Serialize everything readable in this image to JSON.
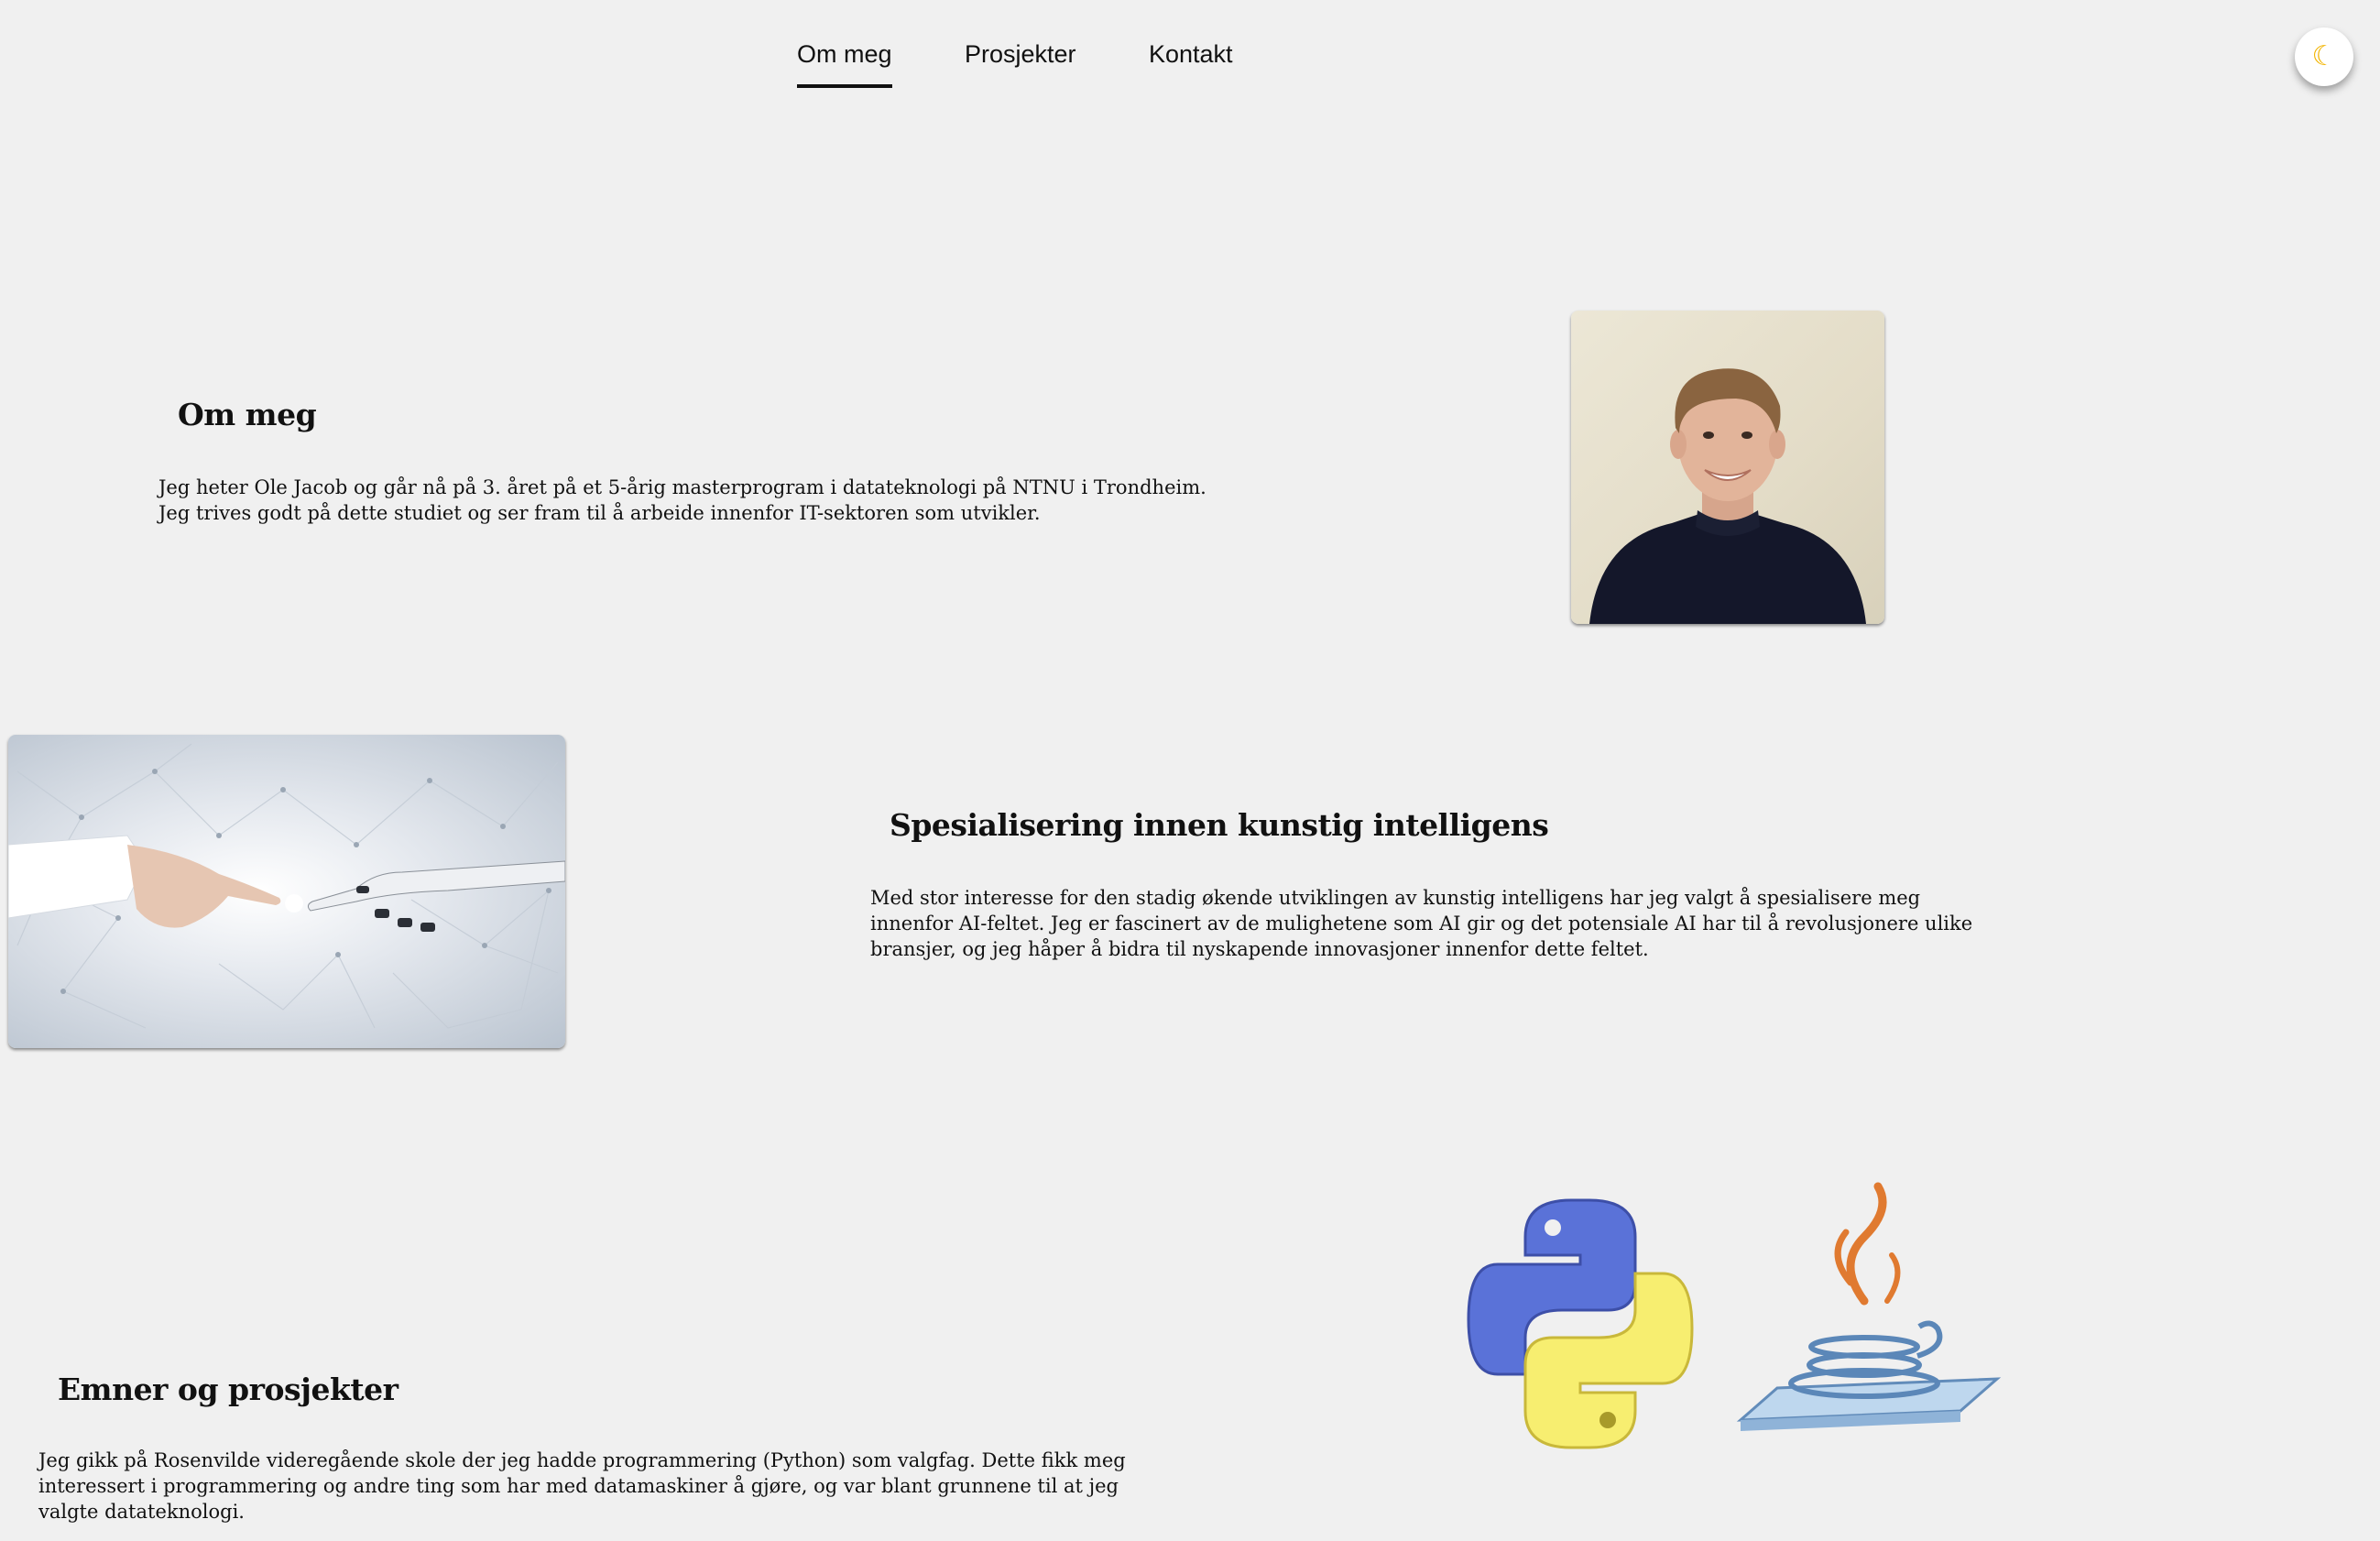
{
  "nav": {
    "items": [
      {
        "label": "Om meg",
        "active": true
      },
      {
        "label": "Prosjekter",
        "active": false
      },
      {
        "label": "Kontakt",
        "active": false
      }
    ],
    "theme_toggle_icon": "moon-icon"
  },
  "about": {
    "heading": "Om meg",
    "text": "Jeg heter Ole Jacob og går nå på 3. året på et 5-årig masterprogram i datateknologi på NTNU i Trondheim. Jeg trives godt på dette studiet og ser fram til å arbeide innenfor IT-sektoren som utvikler."
  },
  "ai": {
    "heading": "Spesialisering innen kunstig intelligens",
    "text": "Med stor interesse for den stadig økende utviklingen av kunstig intelligens har jeg valgt å spesialisere meg innenfor AI-feltet. Jeg er fascinert av de mulighetene som AI gir og det potensiale AI har til å revolusjonere ulike bransjer, og jeg håper å bidra til nyskapende innovasjoner innenfor dette feltet."
  },
  "projects": {
    "heading": "Emner og prosjekter",
    "text": "Jeg gikk på Rosenvilde videregående skole der jeg hadde programmering (Python) som valgfag. Dette fikk meg interessert i programmering og andre ting som har med datamaskiner å gjøre, og var blant grunnene til at jeg valgte datateknologi."
  },
  "colors": {
    "background": "#f0f0f0",
    "python_blue": "#5a72d8",
    "python_yellow": "#f7ee70",
    "java_orange": "#e07a30",
    "java_blue": "#5b87b8"
  }
}
